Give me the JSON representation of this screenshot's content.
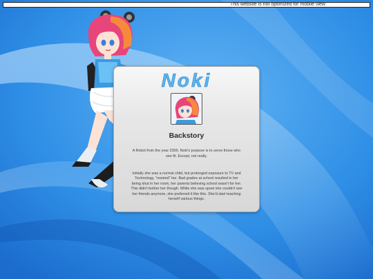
{
  "notice": {
    "text": "This website is not optimized for mobile view"
  },
  "background": {
    "icon": "windows-swoosh-wallpaper",
    "colors": {
      "base": "#2f8fe6",
      "light": "#7fc0f3",
      "dark": "#1560c0"
    }
  },
  "mascot": {
    "icon": "anime-robot-girl-character"
  },
  "card": {
    "logo_text": "Noki",
    "avatar_icon": "noki-portrait-thumbnail",
    "title": "Backstory",
    "intro": "A Robot from the year 2300, Noki's purpose is to serve those who see fit. Except, not really.",
    "body": "Initially she was a normal child, but prolonged exposure to TV and Technology, \"rewired\" her. Bad grades at school resulted in her being shut in her room, her parents believing school wasn't for her. This didn't bother her though. While she was upset she couldn't see her friends anymore, she preferred it like this. She'd start teaching herself various things.",
    "colors": {
      "logo": "#5ab6f0",
      "logo_shadow": "#2a7fc4"
    }
  }
}
